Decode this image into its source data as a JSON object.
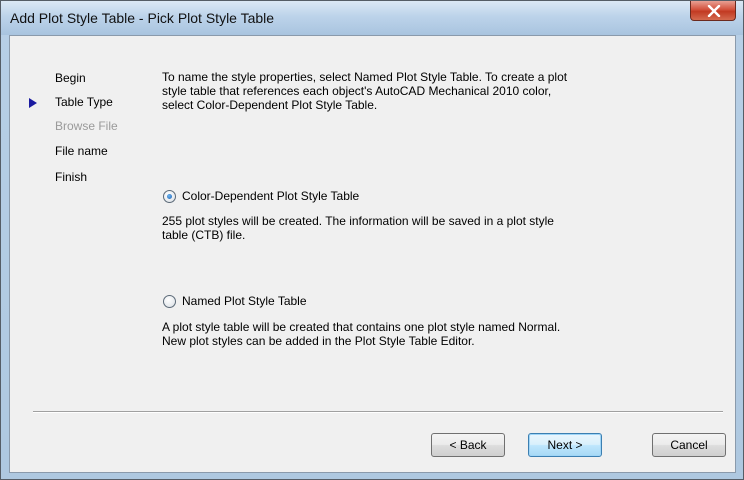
{
  "window": {
    "title": "Add Plot Style Table - Pick Plot Style Table"
  },
  "steps": [
    {
      "label": "Begin",
      "state": "done"
    },
    {
      "label": "Table Type",
      "state": "current"
    },
    {
      "label": "Browse File",
      "state": "disabled"
    },
    {
      "label": "File name",
      "state": "pending"
    },
    {
      "label": "Finish",
      "state": "pending"
    }
  ],
  "intro_text": "To name the style properties, select Named Plot Style Table. To create a plot style table that references each object's AutoCAD Mechanical 2010 color, select Color-Dependent Plot Style Table.",
  "options": [
    {
      "label": "Color-Dependent Plot Style Table",
      "checked": true,
      "description": "255 plot styles will be created. The information will be saved in a plot style table (CTB) file."
    },
    {
      "label": "Named Plot Style Table",
      "checked": false,
      "description": "A plot style table will be created that contains one plot style named Normal.  New plot styles can be added in the Plot Style Table Editor."
    }
  ],
  "buttons": {
    "back": "< Back",
    "next": "Next >",
    "cancel": "Cancel"
  },
  "icons": {
    "close": "close-x-icon",
    "step_pointer": "right-triangle-icon"
  },
  "colors": {
    "step_pointer": "#1a1aa0",
    "close_button": "#c23a22",
    "disabled_text": "#9a9a9a"
  }
}
